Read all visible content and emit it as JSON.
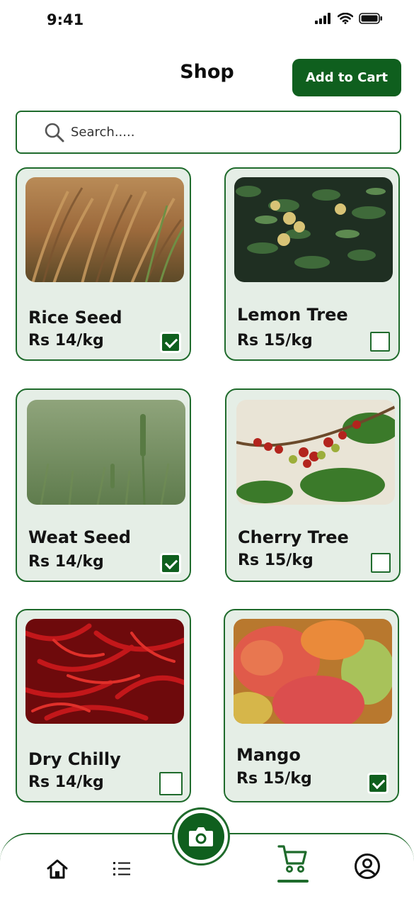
{
  "status": {
    "time": "9:41"
  },
  "header": {
    "title": "Shop",
    "add_to_cart_label": "Add to Cart"
  },
  "search": {
    "placeholder": "Search....."
  },
  "products": [
    {
      "name": "Rice Seed",
      "price": "Rs 14/kg",
      "selected": true,
      "photo": "rice-field"
    },
    {
      "name": "Lemon Tree",
      "price": "Rs 15/kg",
      "selected": false,
      "photo": "lemon-tree"
    },
    {
      "name": "Weat Seed",
      "price": "Rs 14/kg",
      "selected": true,
      "photo": "wheat-field"
    },
    {
      "name": "Cherry Tree",
      "price": "Rs 15/kg",
      "selected": false,
      "photo": "coffee-cherries"
    },
    {
      "name": "Dry Chilly",
      "price": "Rs 14/kg",
      "selected": false,
      "photo": "dry-red-chillies"
    },
    {
      "name": "Mango",
      "price": "Rs 15/kg",
      "selected": true,
      "photo": "mangoes"
    }
  ],
  "nav": {
    "items": [
      "home-icon",
      "list-icon",
      "camera-icon",
      "cart-icon",
      "profile-icon"
    ],
    "active": "cart-icon"
  },
  "colors": {
    "primary": "#0f5f1e",
    "card_bg": "#e5eee6",
    "border": "#1f6b2c"
  }
}
